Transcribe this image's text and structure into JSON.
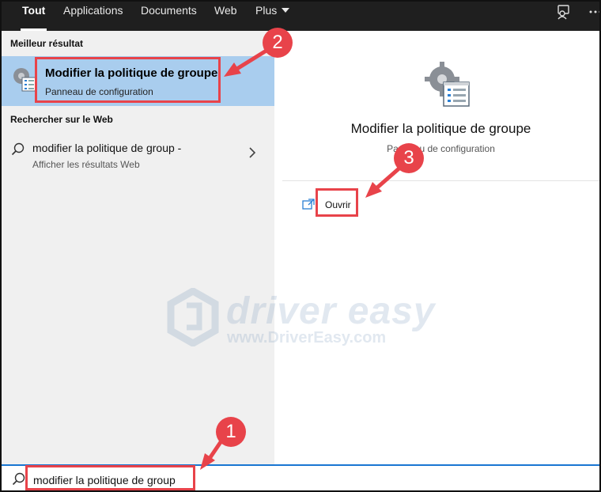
{
  "nav": {
    "tabs": [
      {
        "label": "Tout",
        "active": true
      },
      {
        "label": "Applications",
        "active": false
      },
      {
        "label": "Documents",
        "active": false
      },
      {
        "label": "Web",
        "active": false
      },
      {
        "label": "Plus",
        "active": false
      }
    ],
    "icons": [
      "feedback-icon",
      "more-options-icon"
    ]
  },
  "left": {
    "best_match_label": "Meilleur résultat",
    "best_match": {
      "title": "Modifier la politique de groupe",
      "subtitle": "Panneau de configuration",
      "icon": "group-policy-icon"
    },
    "web_label": "Rechercher sur le Web",
    "web_result": {
      "title": "modifier la politique de group -",
      "subtitle": "Afficher les résultats Web",
      "icon": "search-icon"
    }
  },
  "right": {
    "title": "Modifier la politique de groupe",
    "subtitle": "Panneau de configuration",
    "icon": "group-policy-icon",
    "actions": [
      {
        "label": "Ouvrir",
        "icon": "open-icon"
      }
    ]
  },
  "search": {
    "value": "modifier la politique de group",
    "icon": "search-icon"
  },
  "annotations": [
    {
      "number": "1"
    },
    {
      "number": "2"
    },
    {
      "number": "3"
    }
  ],
  "watermark": {
    "brand": "driver easy",
    "url": "www.DriverEasy.com"
  },
  "colors": {
    "topbar_bg": "#1f1f1f",
    "selected_bg": "#a9cdee",
    "left_bg": "#f0f0f0",
    "annotation_red": "#e8434a",
    "search_accent": "#1976d2"
  }
}
